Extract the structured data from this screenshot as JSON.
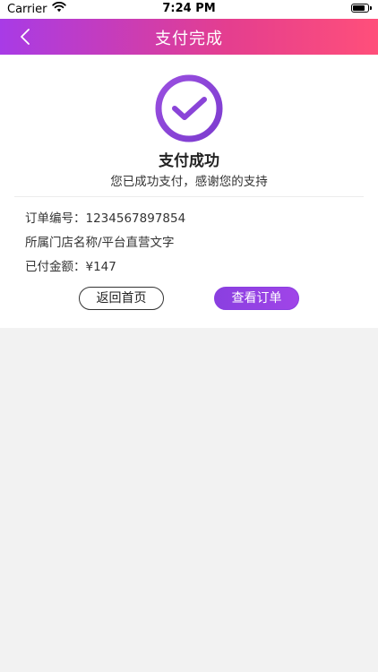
{
  "status_bar": {
    "carrier": "Carrier",
    "time": "7:24 PM"
  },
  "nav": {
    "title": "支付完成",
    "back_icon": "chevron-left-icon"
  },
  "result": {
    "icon": "check-circle-icon",
    "accent_color": "#8a44d8",
    "title": "支付成功",
    "subtitle": "您已成功支付，感谢您的支持"
  },
  "order": {
    "number_label": "订单编号：",
    "number_value": "1234567897854",
    "store_text": "所属门店名称/平台直营文字",
    "amount_label": "已付金额：",
    "amount_value": "¥147"
  },
  "actions": {
    "home_label": "返回首页",
    "view_order_label": "查看订单"
  }
}
